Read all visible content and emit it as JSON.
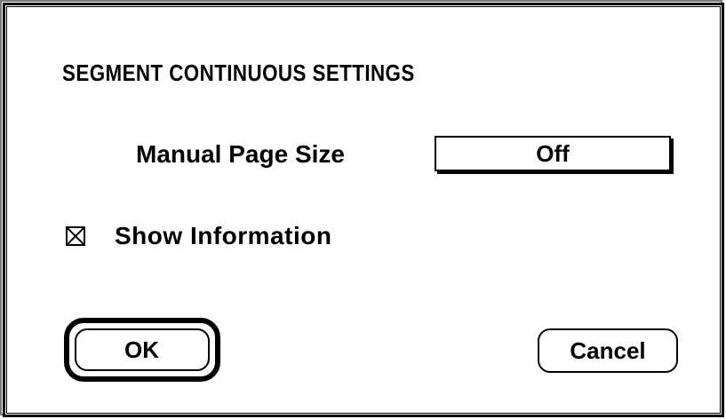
{
  "dialog": {
    "title": "SEGMENT CONTINUOUS SETTINGS",
    "manual_page_size": {
      "label": "Manual Page Size",
      "value": "Off"
    },
    "show_information": {
      "label": "Show Information",
      "checked": true
    },
    "buttons": {
      "ok_label": "OK",
      "cancel_label": "Cancel"
    }
  }
}
